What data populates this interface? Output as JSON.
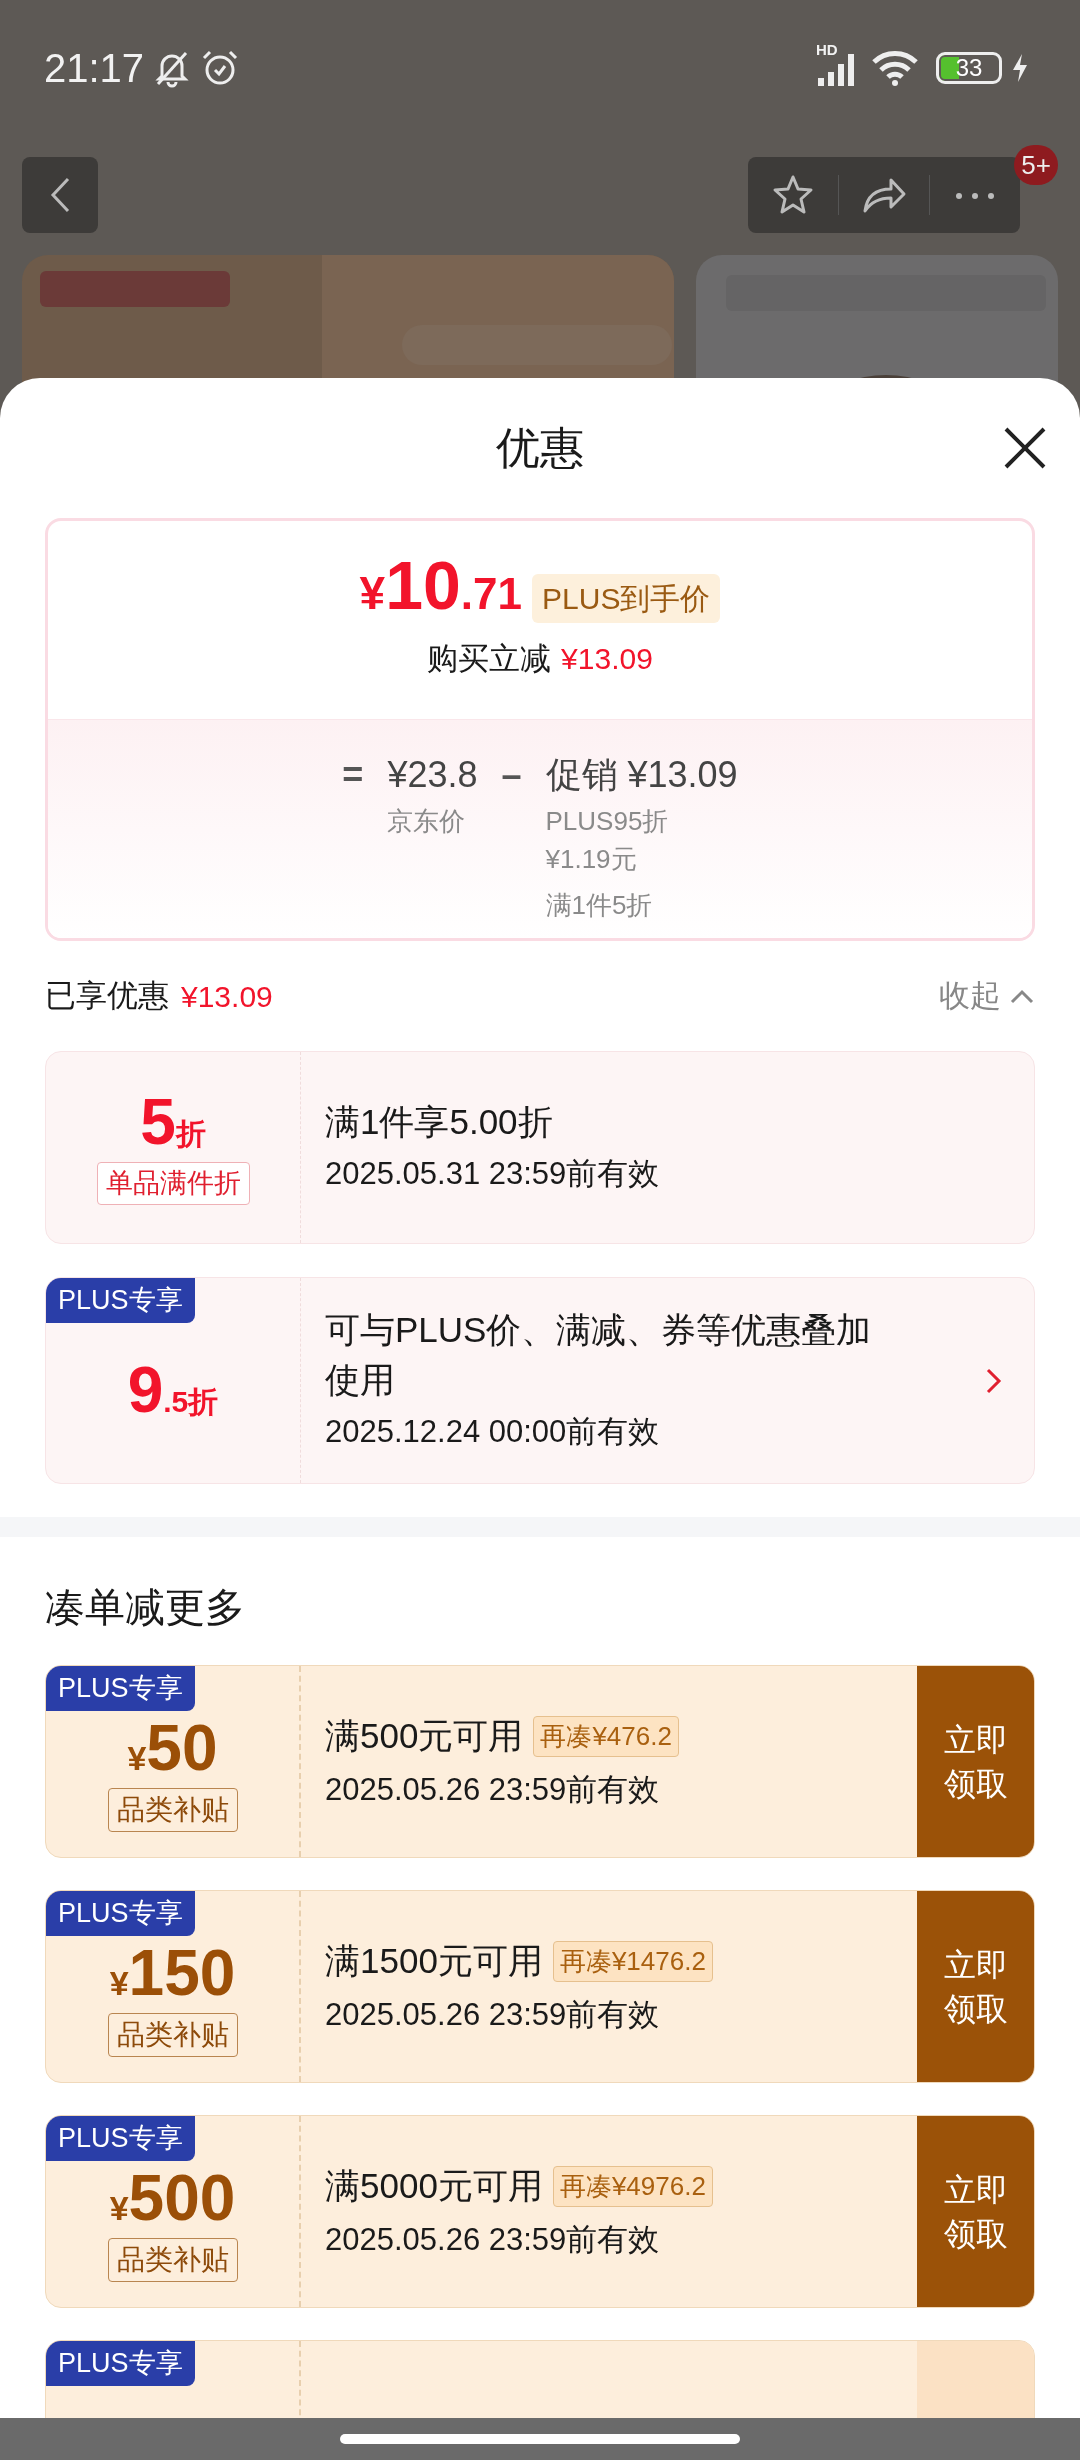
{
  "status_bar": {
    "time": "21:17",
    "network": "HD",
    "battery": "33",
    "charging": true
  },
  "top_bar": {
    "badge": "5+"
  },
  "sheet": {
    "title": "优惠"
  },
  "price_summary": {
    "currency": "¥",
    "price_int": "10",
    "price_dec": ".71",
    "price_tag": "PLUS到手价",
    "instant_label": "购买立减",
    "instant_amount": "¥13.09"
  },
  "breakdown": {
    "equals": "=",
    "base_price": "¥23.8",
    "base_label": "京东价",
    "minus": "–",
    "promo": "促销 ¥13.09",
    "promo_details": [
      "PLUS95折",
      "¥1.19元",
      "满1件5折"
    ]
  },
  "savings": {
    "label": "已享优惠",
    "amount": "¥13.09",
    "toggle": "收起",
    "expanded": true
  },
  "promotions": [
    {
      "value": "5",
      "unit": "折",
      "tag": "单品满件折",
      "title": "满1件享5.00折",
      "validity": "2025.05.31 23:59前有效",
      "clickable": false
    },
    {
      "badge": "PLUS专享",
      "value": "9",
      "unit": ".5折",
      "title": "可与PLUS价、满减、券等优惠叠加使用",
      "validity": "2025.12.24 00:00前有效",
      "clickable": true
    }
  ],
  "coupons_section": {
    "title": "凑单减更多"
  },
  "coupons": [
    {
      "badge": "PLUS专享",
      "currency": "¥",
      "amount": "50",
      "tag": "品类补贴",
      "condition": "满500元可用",
      "gap": "再凑¥476.2",
      "validity": "2025.05.26 23:59前有效",
      "action": "立即领取"
    },
    {
      "badge": "PLUS专享",
      "currency": "¥",
      "amount": "150",
      "tag": "品类补贴",
      "condition": "满1500元可用",
      "gap": "再凑¥1476.2",
      "validity": "2025.05.26 23:59前有效",
      "action": "立即领取"
    },
    {
      "badge": "PLUS专享",
      "currency": "¥",
      "amount": "500",
      "tag": "品类补贴",
      "condition": "满5000元可用",
      "gap": "再凑¥4976.2",
      "validity": "2025.05.26 23:59前有效",
      "action": "立即领取"
    },
    {
      "badge": "PLUS专享"
    }
  ]
}
